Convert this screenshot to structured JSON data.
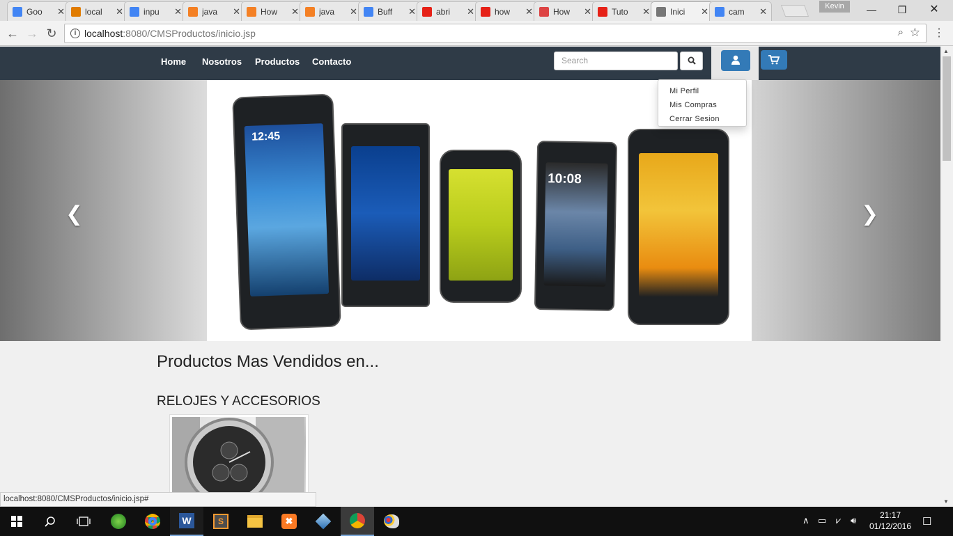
{
  "browser": {
    "tabs": [
      {
        "title": "Goo",
        "icon": "google-g-icon",
        "color": "#4285f4"
      },
      {
        "title": "local",
        "icon": "phpmyadmin-icon",
        "color": "#e07b00"
      },
      {
        "title": "inpu",
        "icon": "google-g-icon",
        "color": "#4285f4"
      },
      {
        "title": "java",
        "icon": "stackoverflow-icon",
        "color": "#f48024"
      },
      {
        "title": "How",
        "icon": "stackoverflow-icon",
        "color": "#f48024"
      },
      {
        "title": "java",
        "icon": "stackoverflow-icon",
        "color": "#f48024"
      },
      {
        "title": "Buff",
        "icon": "google-g-icon",
        "color": "#4285f4"
      },
      {
        "title": "abri",
        "icon": "youtube-icon",
        "color": "#e62117"
      },
      {
        "title": "how",
        "icon": "youtube-icon",
        "color": "#e62117"
      },
      {
        "title": "How",
        "icon": "question-icon",
        "color": "#d44"
      },
      {
        "title": "Tuto",
        "icon": "youtube-icon",
        "color": "#e62117"
      },
      {
        "title": "Inici",
        "icon": "site-icon",
        "color": "#777"
      },
      {
        "title": "cam",
        "icon": "google-g-icon",
        "color": "#4285f4"
      }
    ],
    "active_tab": 11,
    "profile_name": "Kevin",
    "url_host": "localhost",
    "url_rest": ":8080/CMSProductos/inicio.jsp",
    "status_url": "localhost:8080/CMSProductos/inicio.jsp#"
  },
  "site": {
    "nav": [
      "Home",
      "Nosotros",
      "Productos",
      "Contacto"
    ],
    "search_placeholder": "Search",
    "user_menu": [
      "Mi Perfil",
      "Mis Compras",
      "Cerrar Sesion"
    ],
    "carousel_time": "10:08",
    "carousel_time2": "12:45",
    "heading": "Productos Mas Vendidos en...",
    "category": "RELOJES Y ACCESORIOS"
  },
  "taskbar": {
    "time": "21:17",
    "date": "01/12/2016"
  },
  "colors": {
    "navbar": "#2f3b47",
    "button_primary": "#337ab7"
  }
}
